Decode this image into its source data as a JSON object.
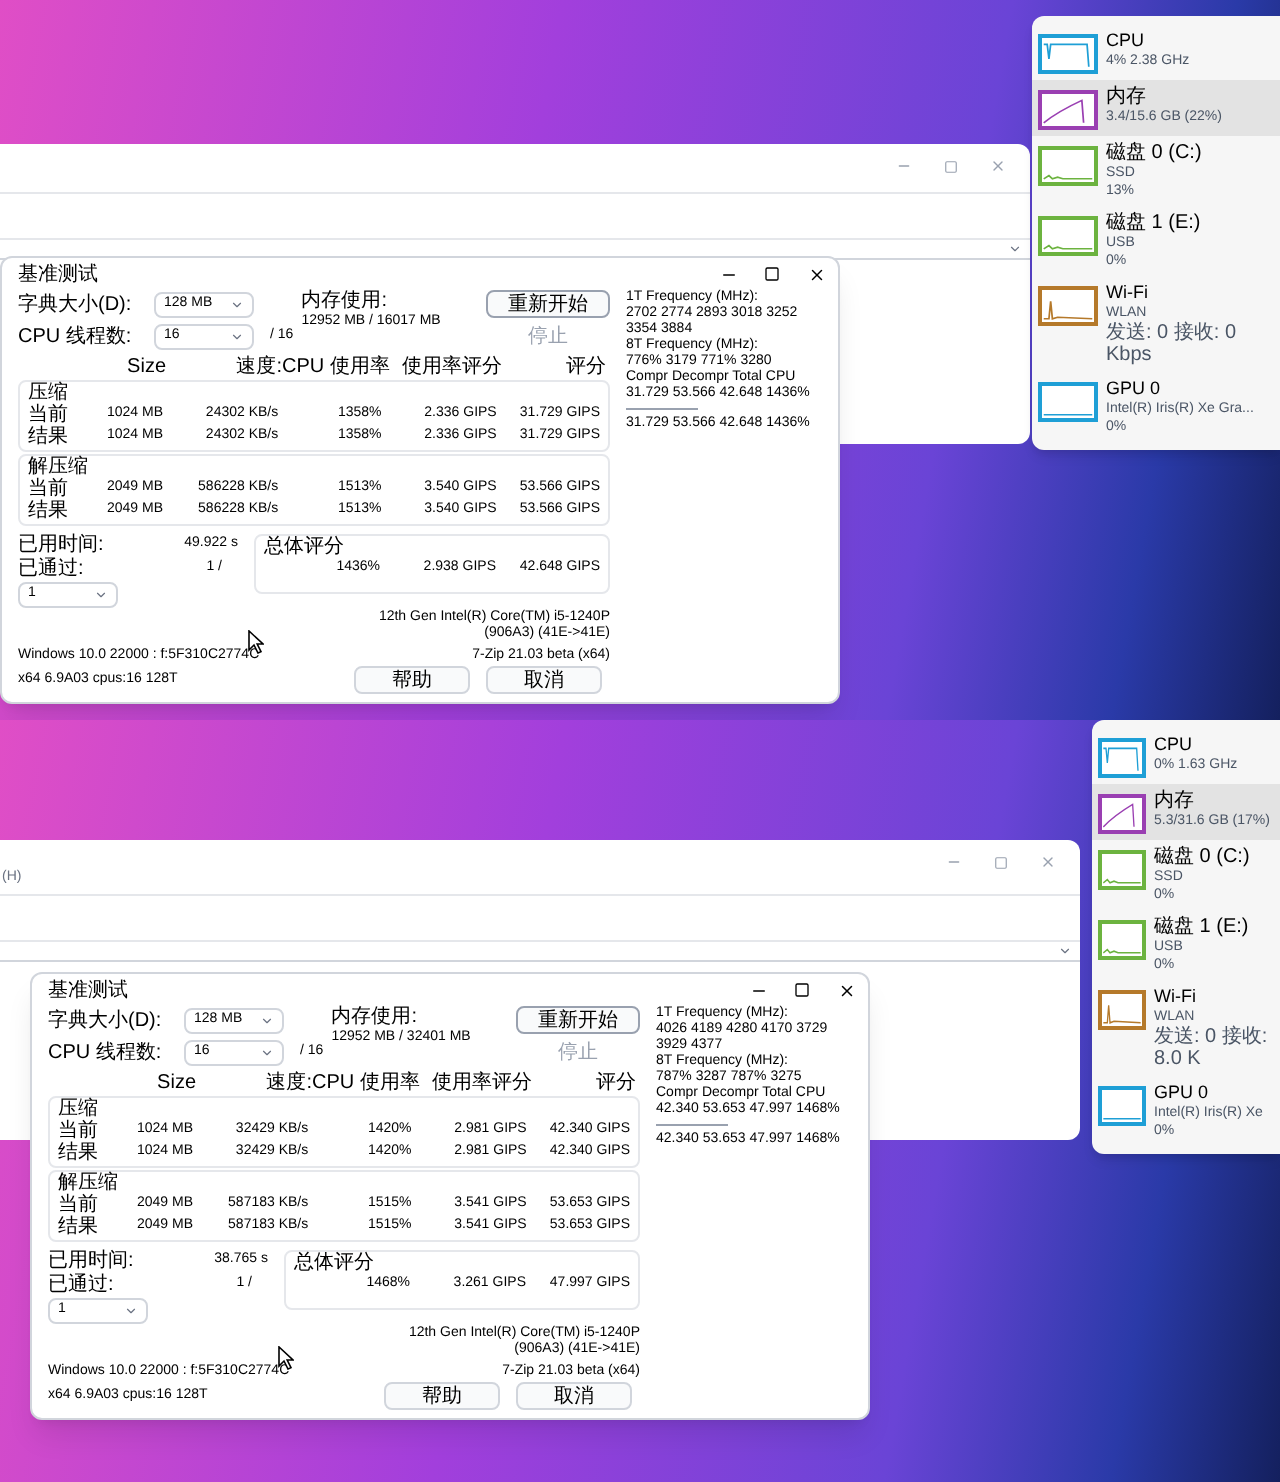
{
  "screens": [
    {
      "benchmark": {
        "title": "基准测试",
        "dictionary": {
          "label": "字典大小(D):",
          "value": "128 MB"
        },
        "memory": {
          "label": "内存使用:",
          "value": "12952 MB / 16017 MB"
        },
        "threads": {
          "label": "CPU 线程数:",
          "value": "16",
          "max": "/ 16"
        },
        "top_buttons": [
          {
            "label": "重新开始",
            "disabled": false
          },
          {
            "label": "停止",
            "disabled": true
          }
        ],
        "columns": [
          "Size",
          "速度:",
          "CPU 使用率",
          "使用率评分",
          "评分"
        ],
        "groups": [
          {
            "title": "压缩",
            "rows": [
              {
                "label": "当前",
                "cells": [
                  "1024 MB",
                  "24302 KB/s",
                  "1358%",
                  "2.336 GIPS",
                  "31.729 GIPS"
                ]
              },
              {
                "label": "结果",
                "cells": [
                  "1024 MB",
                  "24302 KB/s",
                  "1358%",
                  "2.336 GIPS",
                  "31.729 GIPS"
                ]
              }
            ]
          },
          {
            "title": "解压缩",
            "rows": [
              {
                "label": "当前",
                "cells": [
                  "2049 MB",
                  "586228 KB/s",
                  "1513%",
                  "3.540 GIPS",
                  "53.566 GIPS"
                ]
              },
              {
                "label": "结果",
                "cells": [
                  "2049 MB",
                  "586228 KB/s",
                  "1513%",
                  "3.540 GIPS",
                  "53.566 GIPS"
                ]
              }
            ]
          }
        ],
        "elapsed": {
          "label": "已用时间:",
          "value": "49.922 s"
        },
        "passes": {
          "label": "已通过:",
          "value": "1 /",
          "select": "1"
        },
        "total": {
          "title": "总体评分",
          "cells": [
            "1436%",
            "2.938 GIPS",
            "42.648 GIPS"
          ]
        },
        "cpu_name": [
          "12th Gen Intel(R) Core(TM) i5-1240P",
          "(906A3) (41E->41E)"
        ],
        "os": "Windows 10.0 22000 : f:5F310C2774C",
        "version": "7-Zip 21.03 beta (x64)",
        "build": "x64 6.9A03 cpus:16 128T",
        "buttons": [
          "帮助",
          "取消"
        ],
        "log": [
          "1T Frequency (MHz):",
          "2702 2774 2893 3018 3252 3354 3884",
          "8T Frequency (MHz):",
          "776% 3179 771% 3280",
          "Compr Decompr Total CPU",
          "31.729 53.566 42.648 1436%"
        ],
        "log_total": "31.729 53.566 42.648 1436%"
      },
      "task_manager": {
        "items": [
          {
            "kind": "cpu",
            "name": "CPU",
            "details": [
              "4% 2.38 GHz"
            ],
            "color": "#1e9fd6",
            "selected": false
          },
          {
            "kind": "memory",
            "name": "内存",
            "details": [
              "3.4/15.6 GB (22%)"
            ],
            "color": "#9a3fb2",
            "selected": true
          },
          {
            "kind": "disk",
            "name": "磁盘 0 (C:)",
            "details": [
              "SSD",
              "13%"
            ],
            "color": "#6cb33f",
            "selected": false
          },
          {
            "kind": "disk",
            "name": "磁盘 1 (E:)",
            "details": [
              "USB",
              "0%"
            ],
            "color": "#6cb33f",
            "selected": false
          },
          {
            "kind": "network",
            "name": "Wi-Fi",
            "details": [
              "WLAN",
              "发送: 0 接收: 0 Kbps"
            ],
            "color": "#b5792a",
            "selected": false
          },
          {
            "kind": "gpu",
            "name": "GPU 0",
            "details": [
              "Intel(R) Iris(R) Xe Gra...",
              "0%"
            ],
            "color": "#1e9fd6",
            "selected": false
          }
        ]
      }
    },
    {
      "background_window": {
        "menu_fragment": "(H)"
      },
      "benchmark": {
        "title": "基准测试",
        "dictionary": {
          "label": "字典大小(D):",
          "value": "128 MB"
        },
        "memory": {
          "label": "内存使用:",
          "value": "12952 MB / 32401 MB"
        },
        "threads": {
          "label": "CPU 线程数:",
          "value": "16",
          "max": "/ 16"
        },
        "top_buttons": [
          {
            "label": "重新开始",
            "disabled": false
          },
          {
            "label": "停止",
            "disabled": true
          }
        ],
        "columns": [
          "Size",
          "速度:",
          "CPU 使用率",
          "使用率评分",
          "评分"
        ],
        "groups": [
          {
            "title": "压缩",
            "rows": [
              {
                "label": "当前",
                "cells": [
                  "1024 MB",
                  "32429 KB/s",
                  "1420%",
                  "2.981 GIPS",
                  "42.340 GIPS"
                ]
              },
              {
                "label": "结果",
                "cells": [
                  "1024 MB",
                  "32429 KB/s",
                  "1420%",
                  "2.981 GIPS",
                  "42.340 GIPS"
                ]
              }
            ]
          },
          {
            "title": "解压缩",
            "rows": [
              {
                "label": "当前",
                "cells": [
                  "2049 MB",
                  "587183 KB/s",
                  "1515%",
                  "3.541 GIPS",
                  "53.653 GIPS"
                ]
              },
              {
                "label": "结果",
                "cells": [
                  "2049 MB",
                  "587183 KB/s",
                  "1515%",
                  "3.541 GIPS",
                  "53.653 GIPS"
                ]
              }
            ]
          }
        ],
        "elapsed": {
          "label": "已用时间:",
          "value": "38.765 s"
        },
        "passes": {
          "label": "已通过:",
          "value": "1 /",
          "select": "1"
        },
        "total": {
          "title": "总体评分",
          "cells": [
            "1468%",
            "3.261 GIPS",
            "47.997 GIPS"
          ]
        },
        "cpu_name": [
          "12th Gen Intel(R) Core(TM) i5-1240P",
          "(906A3) (41E->41E)"
        ],
        "os": "Windows 10.0 22000 : f:5F310C2774C",
        "version": "7-Zip 21.03 beta (x64)",
        "build": "x64 6.9A03 cpus:16 128T",
        "buttons": [
          "帮助",
          "取消"
        ],
        "log": [
          "1T Frequency (MHz):",
          "4026 4189 4280 4170 3729 3929 4377",
          "8T Frequency (MHz):",
          "787% 3287 787% 3275",
          "Compr Decompr Total CPU",
          "42.340 53.653 47.997 1468%"
        ],
        "log_total": "42.340 53.653 47.997 1468%"
      },
      "task_manager": {
        "items": [
          {
            "kind": "cpu",
            "name": "CPU",
            "details": [
              "0% 1.63 GHz"
            ],
            "color": "#1e9fd6",
            "selected": false
          },
          {
            "kind": "memory",
            "name": "内存",
            "details": [
              "5.3/31.6 GB (17%)"
            ],
            "color": "#9a3fb2",
            "selected": true
          },
          {
            "kind": "disk",
            "name": "磁盘 0 (C:)",
            "details": [
              "SSD",
              "0%"
            ],
            "color": "#6cb33f",
            "selected": false
          },
          {
            "kind": "disk",
            "name": "磁盘 1 (E:)",
            "details": [
              "USB",
              "0%"
            ],
            "color": "#6cb33f",
            "selected": false
          },
          {
            "kind": "network",
            "name": "Wi-Fi",
            "details": [
              "WLAN",
              "发送: 0 接收: 8.0 K"
            ],
            "color": "#b5792a",
            "selected": false
          },
          {
            "kind": "gpu",
            "name": "GPU 0",
            "details": [
              "Intel(R) Iris(R) Xe",
              "0%"
            ],
            "color": "#1e9fd6",
            "selected": false
          }
        ]
      }
    }
  ]
}
